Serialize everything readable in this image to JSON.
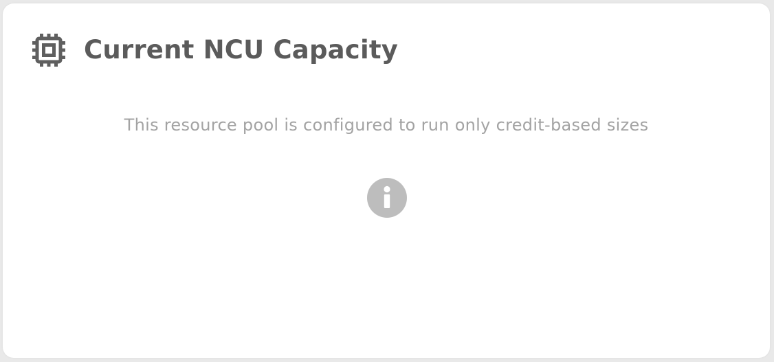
{
  "panel": {
    "title": "Current NCU Capacity",
    "message": "This resource pool is configured to run only credit-based sizes",
    "header_icon": "cpu-chip-icon",
    "status_icon": "info-icon"
  },
  "colors": {
    "title": "#5b5b5b",
    "icon": "#5f5f5f",
    "message": "#a3a3a3",
    "info_circle": "#bdbdbd",
    "card_bg": "#ffffff",
    "page_bg": "#e9e9e9"
  }
}
